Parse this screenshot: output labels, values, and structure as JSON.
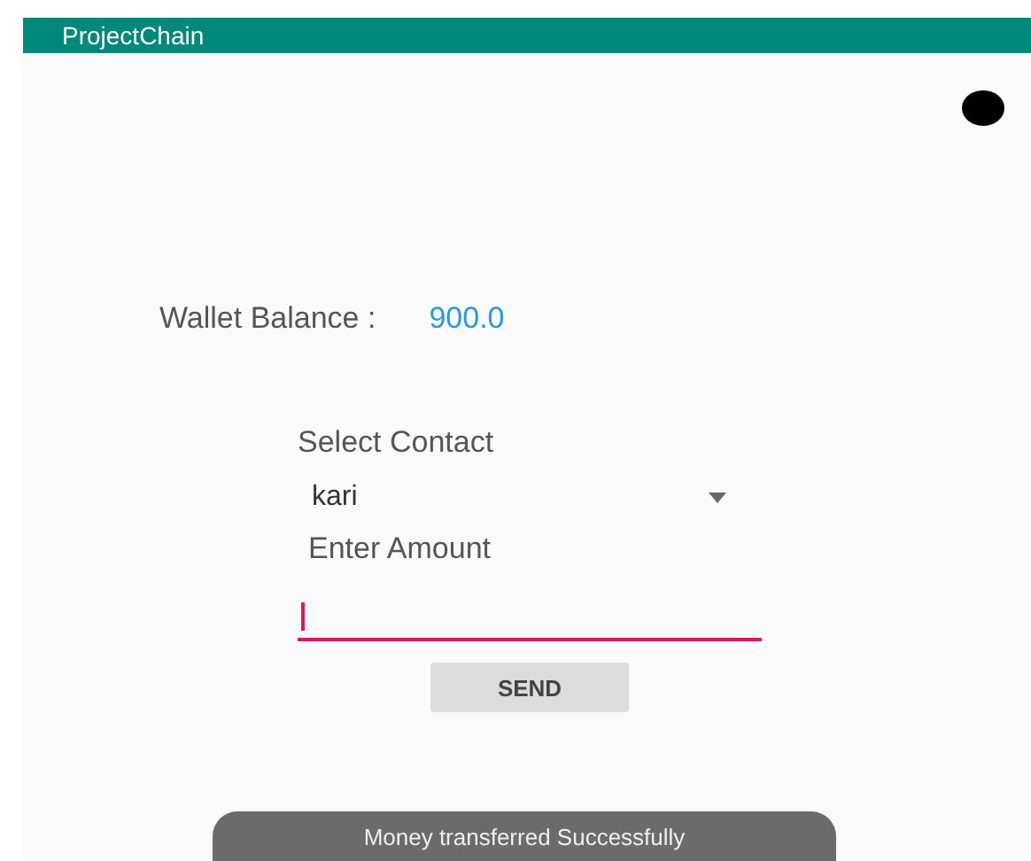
{
  "app_bar": {
    "title": "ProjectChain"
  },
  "wallet": {
    "label": "Wallet Balance :",
    "value": "900.0"
  },
  "contact": {
    "label": "Select Contact",
    "selected_value": "kari"
  },
  "amount": {
    "label": "Enter Amount",
    "focused": true
  },
  "send_button": "SEND",
  "toast": "Money transferred Successfully"
}
